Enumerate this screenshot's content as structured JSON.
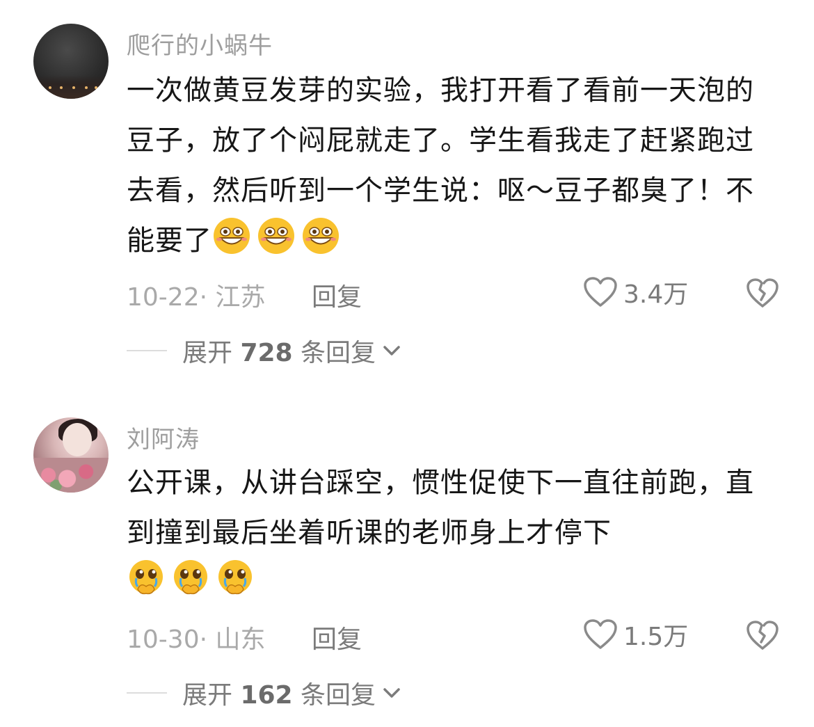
{
  "comments": [
    {
      "username": "爬行的小蜗牛",
      "text": "一次做黄豆发芽的实验，我打开看了看前一天泡的豆子，放了个闷屁就走了。学生看我走了赶紧跑过去看，然后听到一个学生说：呕～豆子都臭了！不能要了",
      "emojis": [
        "grin-emoji",
        "grin-emoji",
        "grin-emoji"
      ],
      "date_location": "10-22· 江苏",
      "reply_label": "回复",
      "like_count": "3.4万",
      "expand_prefix": "展开 ",
      "expand_count": "728",
      "expand_suffix": " 条回复"
    },
    {
      "username": "刘阿涛",
      "text": "公开课，从讲台踩空，惯性促使下一直往前跑，直到撞到最后坐着听课的老师身上才停下",
      "emojis": [
        "pleading-cry-emoji",
        "pleading-cry-emoji",
        "pleading-cry-emoji"
      ],
      "date_location": "10-30· 山东",
      "reply_label": "回复",
      "like_count": "1.5万",
      "expand_prefix": "展开 ",
      "expand_count": "162",
      "expand_suffix": " 条回复"
    }
  ],
  "colors": {
    "username": "#9e9e9e",
    "body": "#161616",
    "meta": "#a9a9a9",
    "action": "#7b7b7b",
    "emoji_yellow": "#f9c22e"
  }
}
